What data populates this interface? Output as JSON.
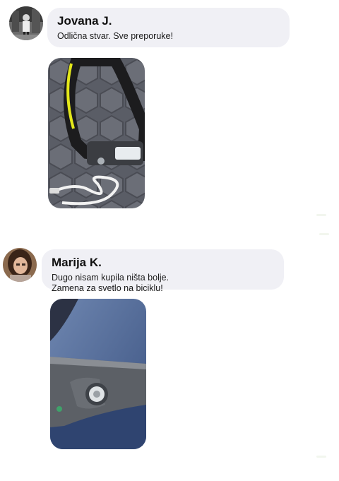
{
  "reviews": [
    {
      "name": "Jovana J.",
      "lines": [
        "Odlična stvar. Sve preporuke!"
      ],
      "avatar_icon": "user-avatar-woman-standing",
      "photo_icon": "headlamp-with-usb-cable-photo"
    },
    {
      "name": "Marija K.",
      "lines": [
        "Dugo nisam kupila ništa bolje.",
        "Zamena za svetlo na biciklu!"
      ],
      "avatar_icon": "user-avatar-woman-portrait",
      "photo_icon": "headlamp-closeup-photo"
    }
  ],
  "colors": {
    "bubble": "#f0f0f5",
    "accent_yellow": "#e4e81a",
    "text": "#111111"
  }
}
